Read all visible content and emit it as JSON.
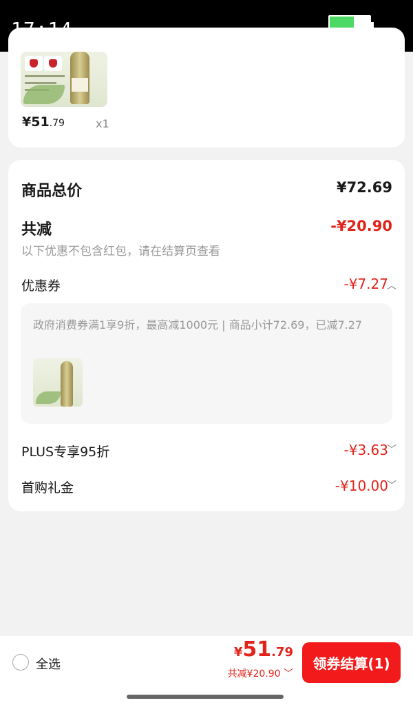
{
  "status_bar": {
    "time": "17:14",
    "battery_level": 0.6
  },
  "product": {
    "price_main": "¥51",
    "price_decimal": ".79",
    "quantity": "x1"
  },
  "summary": {
    "total_label": "商品总价",
    "total_value": "¥72.69",
    "discount_label": "共减",
    "discount_value": "-¥20.90",
    "hint": "以下优惠不包含红包，请在结算页查看",
    "coupon_label": "优惠券",
    "coupon_value": "-¥7.27",
    "coupon_detail": "政府消费券满1享9折，最高减1000元 | 商品小计72.69，已减7.27",
    "plus_label": "PLUS专享95折",
    "plus_value": "-¥3.63",
    "first_label": "首购礼金",
    "first_value": "-¥10.00"
  },
  "bottom_bar": {
    "select_all": "全选",
    "total_yen": "¥",
    "total_int": "51",
    "total_dec": ".79",
    "saved": "共减¥20.90 ﹀",
    "checkout": "领券结算(1)"
  },
  "colors": {
    "accent": "#e2231a",
    "button": "#f21a1a"
  }
}
